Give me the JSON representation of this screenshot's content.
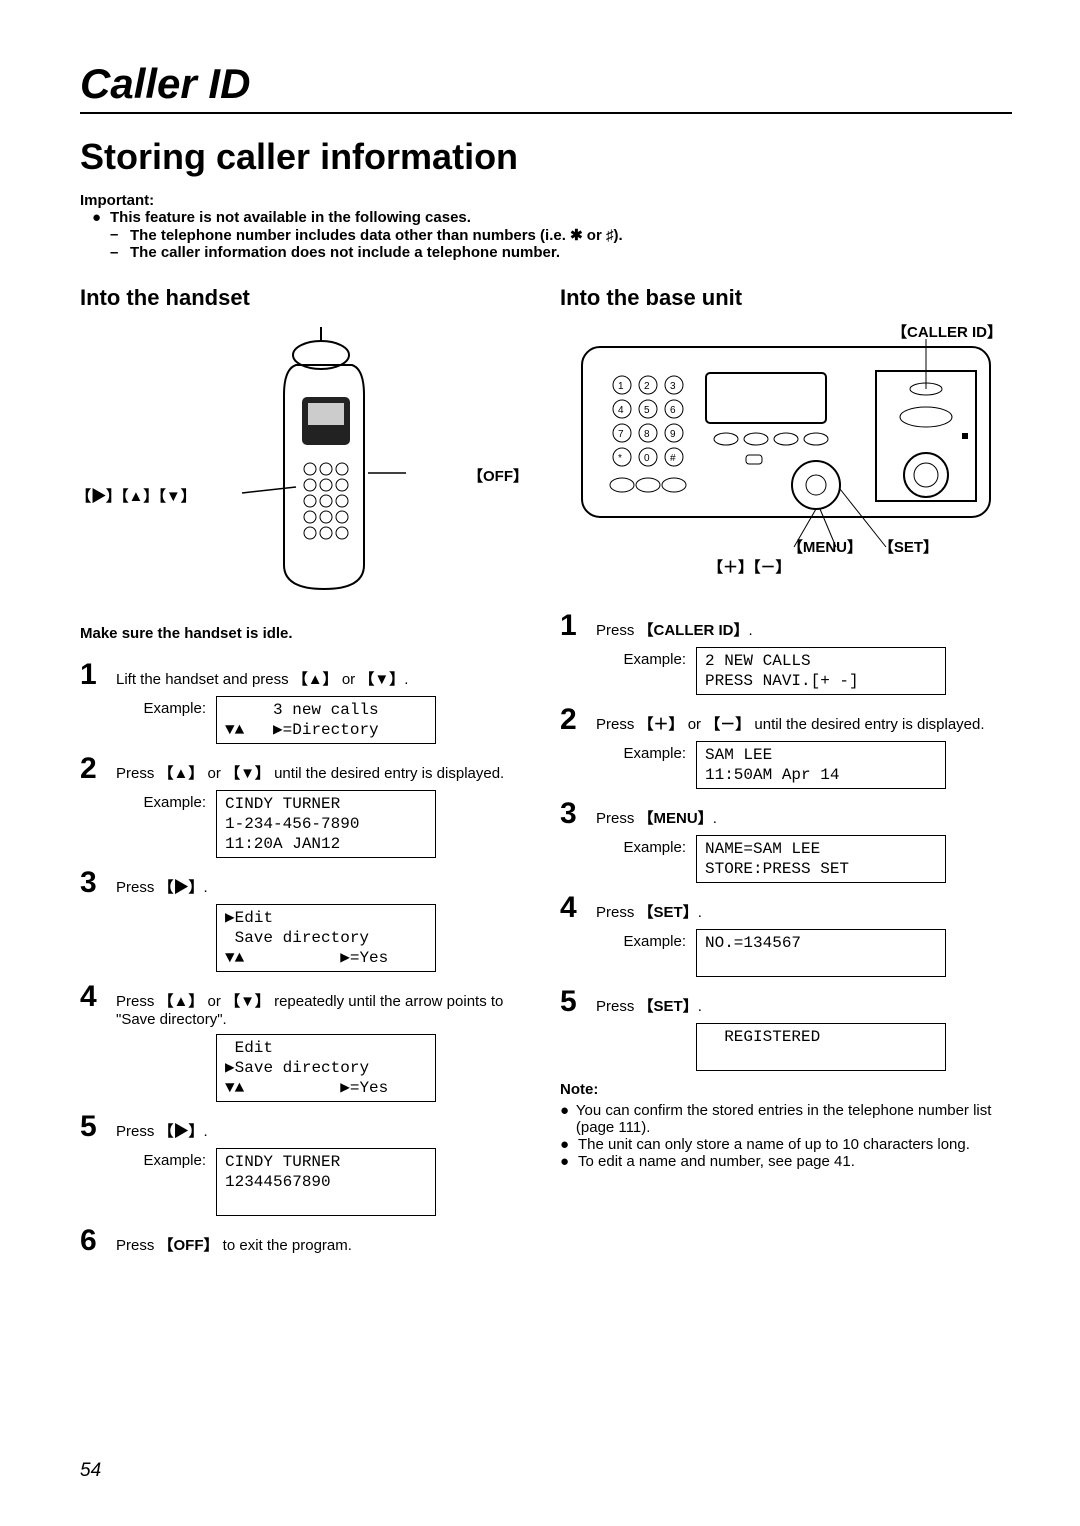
{
  "running_head": "Caller ID",
  "section_title": "Storing caller information",
  "important": {
    "label": "Important:",
    "bullet": "This feature is not available in the following cases.",
    "dash1_pre": "The telephone number includes data other than numbers (i.e. ",
    "dash1_sym1": "✱",
    "dash1_mid": " or ",
    "dash1_sym2": "♯",
    "dash1_post": ").",
    "dash2": "The caller information does not include a telephone number."
  },
  "handset": {
    "heading": "Into the handset",
    "nav_keys_label": "【▶】【▲】【▼】",
    "off_label": "【OFF】",
    "pre_note": "Make sure the handset is idle.",
    "steps": {
      "s1": {
        "text_pre": "Lift the handset and press ",
        "key1": "【▲】",
        "or": " or ",
        "key2": "【▼】",
        "post": ".",
        "example_label": "Example:",
        "lcd": "     3 new calls\n▼▲   ▶=Directory"
      },
      "s2": {
        "text_pre": "Press ",
        "key1": "【▲】",
        "or": " or ",
        "key2": "【▼】",
        "post": " until the desired entry is displayed.",
        "example_label": "Example:",
        "lcd": "CINDY TURNER\n1-234-456-7890\n11:20A JAN12"
      },
      "s3": {
        "text_pre": "Press ",
        "key1": "【▶】",
        "post": ".",
        "lcd": "▶Edit\n Save directory\n▼▲          ▶=Yes"
      },
      "s4": {
        "text_pre": "Press ",
        "key1": "【▲】",
        "or": " or ",
        "key2": "【▼】",
        "post": " repeatedly until the arrow points to \"Save directory\".",
        "lcd": " Edit\n▶Save directory\n▼▲          ▶=Yes"
      },
      "s5": {
        "text_pre": "Press ",
        "key1": "【▶】",
        "post": ".",
        "example_label": "Example:",
        "lcd": "CINDY TURNER\n12344567890\n "
      },
      "s6": {
        "text_pre": "Press ",
        "key1": "【OFF】",
        "post": " to exit the program."
      }
    }
  },
  "base": {
    "heading": "Into the base unit",
    "caller_id_label": "【CALLER ID】",
    "menu_label": "【MENU】",
    "set_label": "【SET】",
    "plus_minus_label": "【＋】【－】",
    "steps": {
      "s1": {
        "text_pre": "Press ",
        "key1": "【CALLER ID】",
        "post": ".",
        "example_label": "Example:",
        "lcd": "2 NEW CALLS\nPRESS NAVI.[+ -]"
      },
      "s2": {
        "text_pre": "Press ",
        "key1": "【＋】",
        "or": " or ",
        "key2": "【－】",
        "post": " until the desired entry is displayed.",
        "example_label": "Example:",
        "lcd": "SAM LEE\n11:50AM Apr 14"
      },
      "s3": {
        "text_pre": "Press ",
        "key1": "【MENU】",
        "post": ".",
        "example_label": "Example:",
        "lcd": "NAME=SAM LEE\nSTORE:PRESS SET"
      },
      "s4": {
        "text_pre": "Press ",
        "key1": "【SET】",
        "post": ".",
        "example_label": "Example:",
        "lcd": "NO.=134567\n "
      },
      "s5": {
        "text_pre": "Press ",
        "key1": "【SET】",
        "post": ".",
        "lcd": "  REGISTERED\n "
      }
    },
    "note": {
      "label": "Note:",
      "n1": "You can confirm the stored entries in the telephone number list (page 111).",
      "n2": "The unit can only store a name of up to 10 characters long.",
      "n3": "To edit a name and number, see page 41."
    }
  },
  "page_number": "54"
}
